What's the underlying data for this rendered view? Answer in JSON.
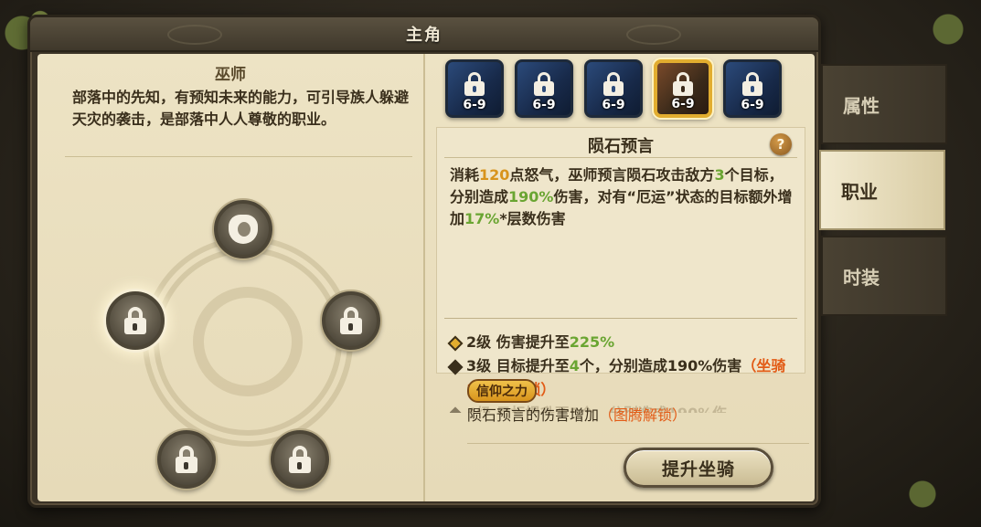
{
  "window": {
    "title": "主角"
  },
  "class_info": {
    "name": "巫师",
    "description": "部落中的先知，有预知未来的能力，可引导族人躲避天灾的袭击，是部落中人人尊敬的职业。"
  },
  "talent_wheel": {
    "nodes": [
      {
        "id": "top",
        "icon": "hand-icon",
        "locked": false
      },
      {
        "id": "left",
        "icon": "lock-icon",
        "locked": true,
        "selected": true
      },
      {
        "id": "right",
        "icon": "lock-icon",
        "locked": true
      },
      {
        "id": "bottom-left",
        "icon": "lock-icon",
        "locked": true
      },
      {
        "id": "bottom-right",
        "icon": "lock-icon",
        "locked": true
      }
    ]
  },
  "skills": [
    {
      "level_req": "6-9",
      "locked": true,
      "selected": false
    },
    {
      "level_req": "6-9",
      "locked": true,
      "selected": false
    },
    {
      "level_req": "6-9",
      "locked": true,
      "selected": false
    },
    {
      "level_req": "6-9",
      "locked": true,
      "selected": true
    },
    {
      "level_req": "6-9",
      "locked": true,
      "selected": false
    }
  ],
  "skill_detail": {
    "name": "陨石预言",
    "help_label": "?",
    "desc_parts": {
      "p1": "消耗",
      "rage": "120",
      "p2": "点怒气，巫师预言陨石攻击敌方",
      "targets": "3",
      "p3": "个目标，分别造成",
      "damage": "190%",
      "p4": "伤害，对有“厄运”状态的目标额外增加",
      "bonus": "17%",
      "p5": "*层数伤害"
    },
    "upgrades": [
      {
        "level": "2级",
        "text": "伤害提升至",
        "value": "225%",
        "extra": "",
        "lock": ""
      },
      {
        "level": "3级",
        "text": "目标提升至",
        "value": "4",
        "extra": "个，分别造成190%伤害",
        "lock": "（坐骑101级解锁）"
      }
    ],
    "faded_row": "4级 目标提升至5个，分别造成190%伤"
  },
  "faith": {
    "badge": "信仰之力",
    "desc": "陨石预言的伤害增加",
    "lock": "（图腾解锁）"
  },
  "buttons": {
    "upgrade_mount": "提升坐骑"
  },
  "side_tabs": [
    {
      "label": "属性",
      "active": false
    },
    {
      "label": "职业",
      "active": true
    },
    {
      "label": "时装",
      "active": false
    }
  ],
  "colors": {
    "accent_gold": "#e2ad2f",
    "highlight_orange": "#d8941c",
    "highlight_green": "#6aa532",
    "lock_red": "#e25b16",
    "parchment": "#ede3c4"
  }
}
